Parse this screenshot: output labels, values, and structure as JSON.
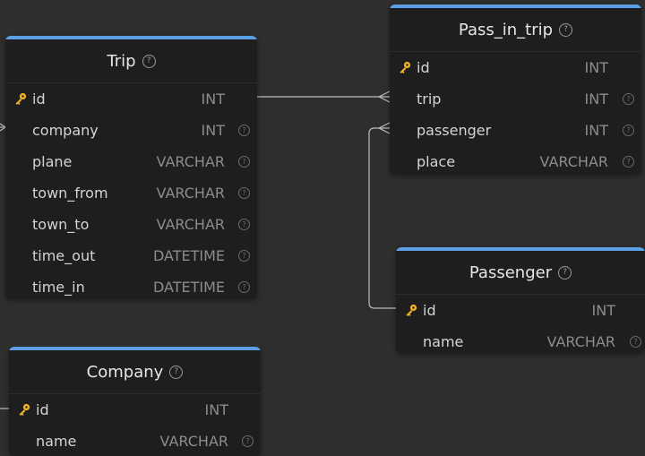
{
  "tables": {
    "trip": {
      "title": "Trip",
      "fields": [
        {
          "name": "id",
          "type": "INT"
        },
        {
          "name": "company",
          "type": "INT"
        },
        {
          "name": "plane",
          "type": "VARCHAR"
        },
        {
          "name": "town_from",
          "type": "VARCHAR"
        },
        {
          "name": "town_to",
          "type": "VARCHAR"
        },
        {
          "name": "time_out",
          "type": "DATETIME"
        },
        {
          "name": "time_in",
          "type": "DATETIME"
        }
      ]
    },
    "pass_in_trip": {
      "title": "Pass_in_trip",
      "fields": [
        {
          "name": "id",
          "type": "INT"
        },
        {
          "name": "trip",
          "type": "INT"
        },
        {
          "name": "passenger",
          "type": "INT"
        },
        {
          "name": "place",
          "type": "VARCHAR"
        }
      ]
    },
    "passenger": {
      "title": "Passenger",
      "fields": [
        {
          "name": "id",
          "type": "INT"
        },
        {
          "name": "name",
          "type": "VARCHAR"
        }
      ]
    },
    "company": {
      "title": "Company",
      "fields": [
        {
          "name": "id",
          "type": "INT"
        },
        {
          "name": "name",
          "type": "VARCHAR"
        }
      ]
    }
  },
  "colors": {
    "background": "#2e2e2e",
    "card": "#1e1e1e",
    "accent": "#5b9fe6",
    "key_icon": "#f0b429",
    "connector": "#bdbdbd"
  },
  "icons": {
    "primary_key": "key-icon",
    "help": "help-circle-icon",
    "info": "info-circle-icon",
    "relation": "crows-foot-icon"
  }
}
